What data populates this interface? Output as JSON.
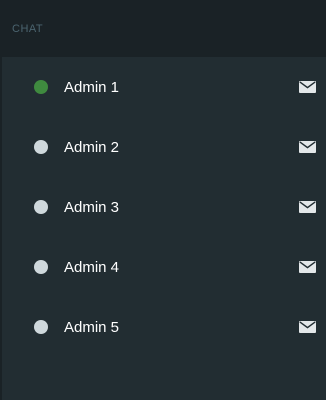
{
  "header": {
    "label": "CHAT"
  },
  "colors": {
    "online": "#3f8a3f",
    "offline": "#cfd8dc",
    "mail": "#e3e7e9"
  },
  "admins": [
    {
      "name": "Admin 1",
      "status": "online"
    },
    {
      "name": "Admin 2",
      "status": "offline"
    },
    {
      "name": "Admin 3",
      "status": "offline"
    },
    {
      "name": "Admin 4",
      "status": "offline"
    },
    {
      "name": "Admin 5",
      "status": "offline"
    }
  ],
  "icons": {
    "status": "status-dot-icon",
    "message": "envelope-icon"
  }
}
